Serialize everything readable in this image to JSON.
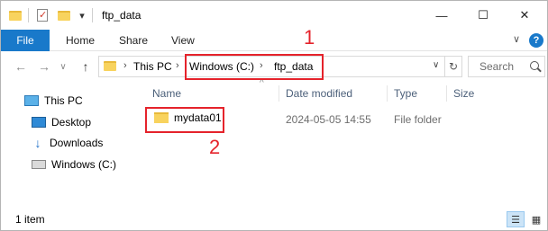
{
  "window": {
    "title": "ftp_data",
    "controls": {
      "minimize": "—",
      "maximize": "☐",
      "close": "✕"
    }
  },
  "quick_access": {
    "checkmark": "✓",
    "dropdown": "▾"
  },
  "ribbon": {
    "file_tab": "File",
    "tabs": [
      "Home",
      "Share",
      "View"
    ],
    "collapse": "∨",
    "help": "?"
  },
  "navigation": {
    "back": "←",
    "forward": "→",
    "recent": "∨",
    "up": "↑"
  },
  "address": {
    "crumbs": [
      "This PC",
      "Windows (C:)",
      "ftp_data"
    ],
    "separator": "›",
    "dropdown": "∨",
    "refresh": "↻"
  },
  "search": {
    "placeholder": "Search"
  },
  "nav_pane": {
    "items": [
      {
        "label": "This PC",
        "icon": "computer-icon"
      },
      {
        "label": "Desktop",
        "icon": "desktop-icon"
      },
      {
        "label": "Downloads",
        "icon": "download-arrow-icon"
      },
      {
        "label": "Windows (C:)",
        "icon": "drive-icon"
      }
    ]
  },
  "columns": {
    "name": "Name",
    "date": "Date modified",
    "type": "Type",
    "size": "Size",
    "sort": "^"
  },
  "files": [
    {
      "name": "mydata01",
      "date": "2024-05-05 14:55",
      "type": "File folder",
      "size": ""
    }
  ],
  "annotations": {
    "label1": "1",
    "label2": "2",
    "color": "#e5232b"
  },
  "status": {
    "count": "1 item"
  },
  "colors": {
    "accent": "#1979ca",
    "folder": "#f8d35e"
  }
}
